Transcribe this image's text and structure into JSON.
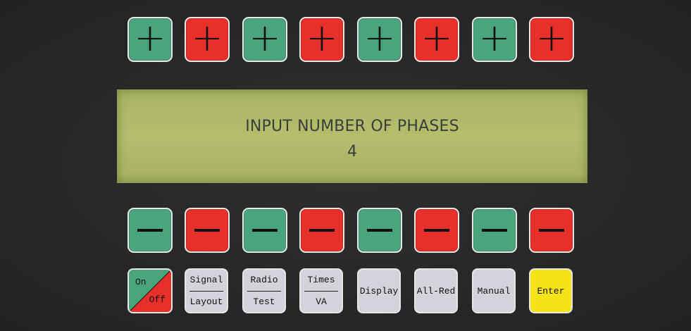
{
  "plus_row": [
    {
      "color": "green",
      "symbol": "+"
    },
    {
      "color": "red",
      "symbol": "+"
    },
    {
      "color": "green",
      "symbol": "+"
    },
    {
      "color": "red",
      "symbol": "+"
    },
    {
      "color": "green",
      "symbol": "+"
    },
    {
      "color": "red",
      "symbol": "+"
    },
    {
      "color": "green",
      "symbol": "+"
    },
    {
      "color": "red",
      "symbol": "+"
    }
  ],
  "minus_row": [
    {
      "color": "green"
    },
    {
      "color": "red"
    },
    {
      "color": "green"
    },
    {
      "color": "red"
    },
    {
      "color": "green"
    },
    {
      "color": "red"
    },
    {
      "color": "green"
    },
    {
      "color": "red"
    }
  ],
  "display": {
    "line1": "INPUT NUMBER OF PHASES",
    "line2": "4"
  },
  "function_keys": {
    "on_off": {
      "on": "On",
      "off": "Off"
    },
    "signal_layout": {
      "top": "Signal",
      "bottom": "Layout"
    },
    "radio_test": {
      "top": "Radio",
      "bottom": "Test"
    },
    "times_va": {
      "top": "Times",
      "bottom": "VA"
    },
    "display": "Display",
    "all_red": "All-Red",
    "manual": "Manual",
    "enter": "Enter"
  },
  "colors": {
    "green": "#4aa57e",
    "red": "#e8302b",
    "lcd": "#b0ba69",
    "enter": "#f6e316",
    "function_key": "#d3d3dc"
  }
}
